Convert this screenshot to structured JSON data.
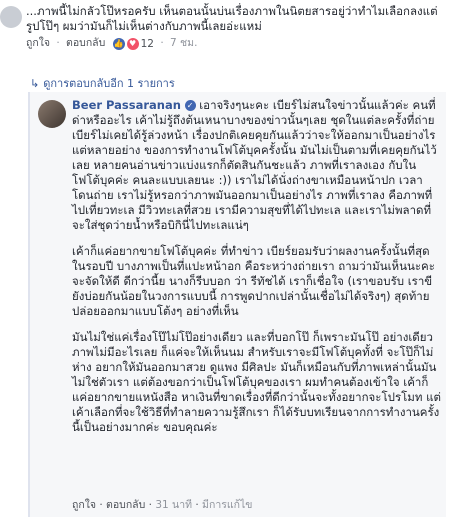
{
  "top_comment": {
    "text": "...ภาพนี้ไม่กลัวโป๊หรอครับ เห็นตอนนั้นบ่นเรื่องภาพในนิตยสารอยู่ว่าทำไมเลือกลงแต่รูปโป๊ๆ ผมว่ามันก็ไม่เห็นต่างกับภาพนี้เลยอ่ะแหม่",
    "like": "ถูกใจ",
    "reply": "ตอบกลับ",
    "count": "12",
    "time": "7 ชม."
  },
  "replies_link": {
    "icon": "reply-arrow-icon",
    "text": "ดูการตอบกลับอีก 1 รายการ"
  },
  "reply": {
    "author": "Beer Passaranan",
    "verified_icon": "verified-icon",
    "para1": "เอาจริงๆนะคะ เบียร์ไม่สนใจข่าวนั้นแล้วค่ะ คนที่ด่าหรืออะไร เค้าไม่รู้ถึงต้นเหนาบางของข่าวนั้นๆเลย ชุดในแต่ละครั้งที่ถ่าย เบียร์ไม่เคยได้รู้ล่วงหน้า เรื่องปกติเคยคุยกันแล้วว่าจะให้ออกมาเป็นอย่างไร แต่หลายอย่าง ของการทำงานโฟโต้บุคครั้งนั้น มันไม่เป็นตามที่เคยคุยกันไว้เลย หลายคนอ่านข่าวแบ่งแรกก็ตัดสินกันชะแล้ว ภาพที่เราลงเอง กับในโฟโต้บุคค่ะ คนละแบบเลยนะ :)) เราไม่ได้นั่งถ่างขาเหมือนหน้าปก เวลาโดนถ่าย เราไม่รู้หรอกว่าภาพมันออกมาเป็นอย่างไร ภาพที่เราลง คือภาพที่ไปเที่ยวทะเล มีวิวทะเลที่สวย เรามีความสุขที่ได้ไปทะเล และเราไม่พลาดที่จะใส่ชุดว่ายน้ำหรือบิกินี่ไปทะเลแน่ๆ",
    "para2": "เค้าก็แค่อยากขายโฟโต้บุคค่ะ ที่ทำข่าว เบียร์ยอมรับว่าผลงานครั้งนั้นที่สุดในรอบปี บางภาพเป็นที่แปะหน้าอก คือระหว่างถ่ายเรา ถามว่ามันเห็นนะคะ จะจัดให้ดี ดีกว่านี้ย นางก็รีบบอก ว่า รีทัชได้ เราก็เชื่อใจ (เราขอบรับ เราขียังบ่อยกันน้อยในวงการแบบนี้ การพูดปากเปล่านั้นเชื่อไม่ได้จริงๆ) สุดท้ายปล่อยออกมาแบบโต้งๆ อย่างที่เห็น",
    "para3": "มันไม่ใช่แค่เรื่องโป๊ไม่โป๊อย่างเดียว และที่บอกโป๊ ก็เพราะมันโป๊ อย่างเดียว ภาพไม่มีอะไรเลย ก็แค่จะให้เห็นนม สำหรับเราจะมีโฟโต้บุคทั้งที่ จะโป๊ก็ไม่ห่าง อยากให้มันออกมาสวย ดูแพง มีศิลปะ มันก็เหมือนกับที่ภาพเหล่านั้นมันไม่ใช่ตัวเรา แต่ต้องขอกว่าเป็นโฟโต้บุคของเรา ผมทำคนต้องเข้าใจ เค้าก็แค่อยากขายแหนังสือ หาเงินที่ขาดเรื่องที่ดีกว่านั้นจะทั้งอยากจะโปรโมท แต่เค้าเลือกที่จะใช้วิธีที่ทำลายความรู้สึกเรา ก็ได้รับบทเรียนจากการทำงานครั้งนี้เป็นอย่างมากค่ะ ขอบคุณค่ะ",
    "like": "ถูกใจ",
    "reply": "ตอบกลับ",
    "time": "31 นาที",
    "edited": "มีการแก้ไข"
  }
}
